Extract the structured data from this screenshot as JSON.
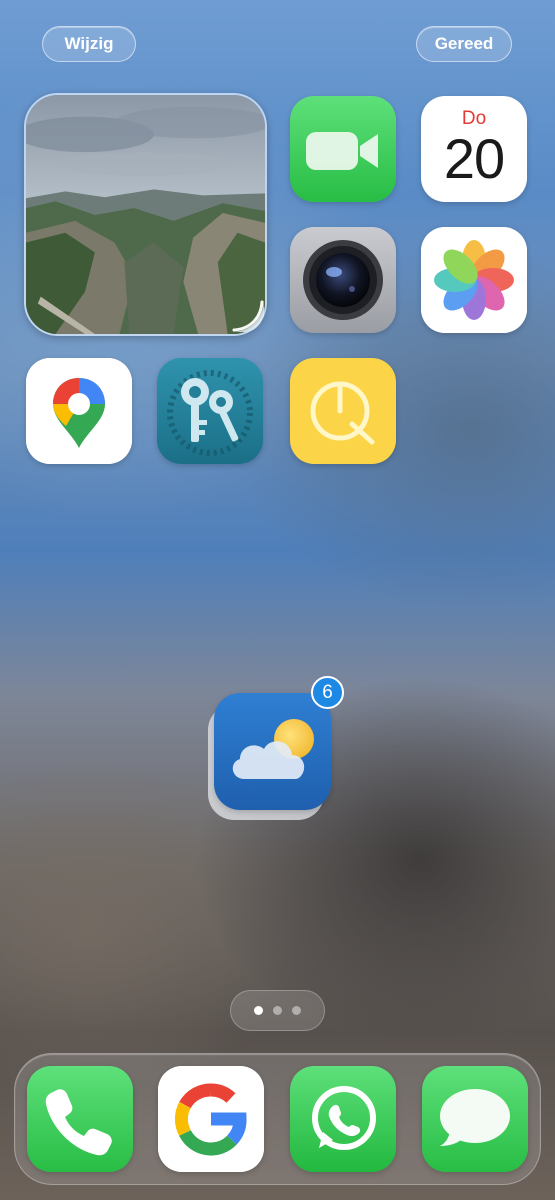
{
  "header": {
    "edit_label": "Wijzig",
    "done_label": "Gereed"
  },
  "widgets": {
    "photo_widget": {
      "kind": "photo",
      "subject": "mountain gorge landscape"
    }
  },
  "apps": {
    "facetime": {
      "icon": "facetime-icon"
    },
    "calendar": {
      "icon": "calendar-icon",
      "weekday": "Do",
      "date": "20"
    },
    "camera": {
      "icon": "camera-icon"
    },
    "photos": {
      "icon": "photos-icon"
    },
    "maps": {
      "icon": "google-maps-icon"
    },
    "keys": {
      "icon": "keys-icon"
    },
    "quick": {
      "icon": "quick-app-icon"
    },
    "weather": {
      "icon": "weather-icon",
      "badge": "6",
      "state": "dragging"
    }
  },
  "page_indicator": {
    "pages": 3,
    "current": 1
  },
  "dock": [
    {
      "id": "phone",
      "icon": "phone-icon"
    },
    {
      "id": "google",
      "icon": "google-icon"
    },
    {
      "id": "whatsapp",
      "icon": "whatsapp-icon"
    },
    {
      "id": "messages",
      "icon": "messages-icon"
    }
  ],
  "colors": {
    "accent_green": "#34c759",
    "badge_blue": "#1e88e5",
    "calendar_red": "#e53935",
    "quick_yellow": "#fbd448"
  }
}
